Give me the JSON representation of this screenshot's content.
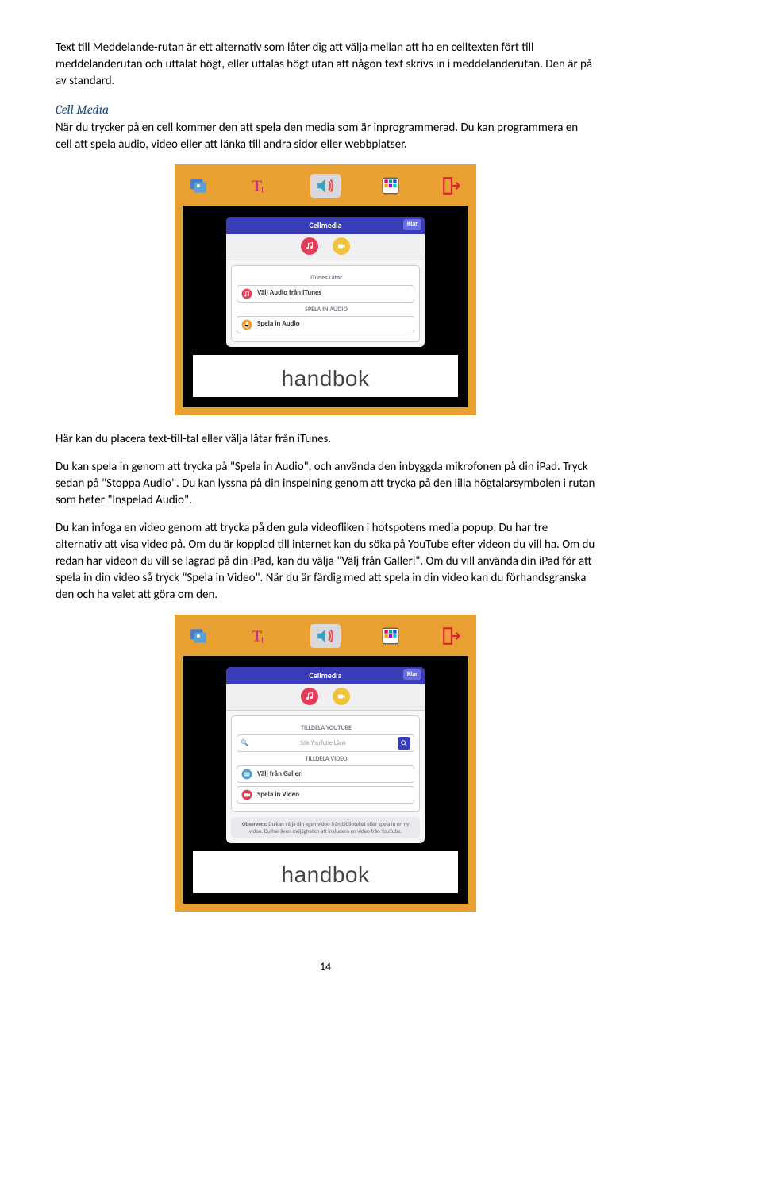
{
  "para1": "Text till Meddelande-rutan är ett alternativ som låter dig att välja mellan att ha en celltexten fört till meddelanderutan och uttalat högt, eller uttalas högt utan att någon text skrivs in i meddelanderutan. Den är på av standard.",
  "heading_cell_media": "Cell Media",
  "para2": "När du trycker på en cell kommer den att spela den media som är inprogrammerad. Du kan programmera en cell att spela audio, video eller att länka till andra sidor eller webbplatser.",
  "para3": "Här kan du placera text-till-tal eller välja låtar från iTunes.",
  "para4": "Du kan spela in genom att trycka på \"Spela in Audio\", och använda den inbyggda mikrofonen på din iPad. Tryck sedan på \"Stoppa Audio\". Du kan lyssna på din inspelning genom att trycka på den lilla högtalarsymbolen i rutan som heter \"Inspelad Audio\".",
  "para5": "Du kan infoga en video genom att trycka på den gula videofliken i hotspotens media popup. Du har tre alternativ att visa video på. Om du är kopplad till internet kan du söka på YouTube efter videon du vill ha. Om du redan har videon du vill se lagrad på din iPad, kan du välja \"Välj från Galleri\". Om du vill använda din iPad för att spela in din video så tryck \"Spela in Video\". När du är färdig med att spela in din video kan du förhandsgranska den och ha valet att göra om den.",
  "popup": {
    "title": "Cellmedia",
    "done": "Klar",
    "itunes_header": "iTunes Låtar",
    "itunes_row": "Välj Audio från iTunes",
    "spela_in_header": "SPELA IN AUDIO",
    "spela_in_row": "Spela in Audio",
    "youtube_header": "TILLDELA YOUTUBE",
    "youtube_placeholder": "Sök YouTube Länk",
    "video_header": "TILLDELA VIDEO",
    "video_row1": "Välj från Galleri",
    "video_row2": "Spela in Video",
    "observera": "Observera: Du kan välja din egen video från biblioteket eller spela in en ny video. Du har även möjligheten att inkludera en video från YouTube."
  },
  "handbok": "handbok",
  "page_number": "14"
}
